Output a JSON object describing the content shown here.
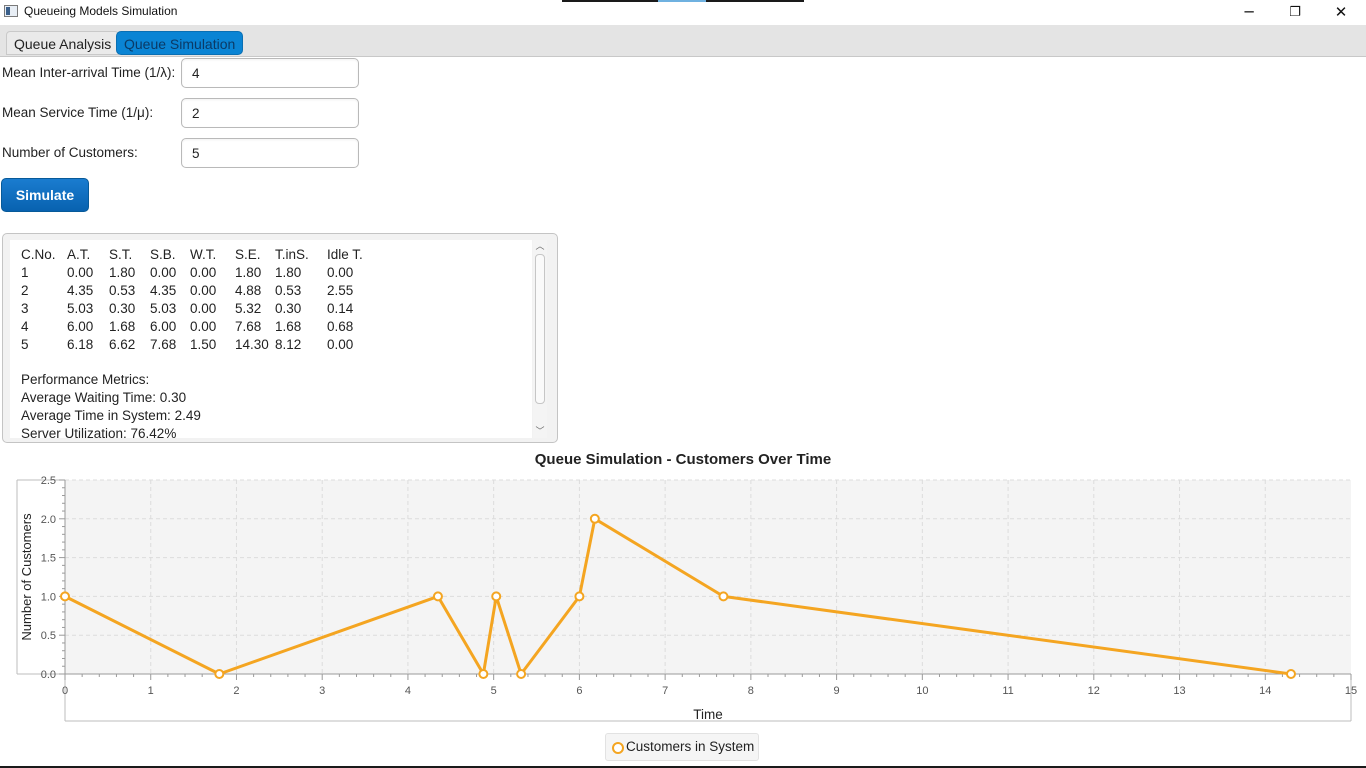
{
  "window": {
    "title": "Queueing Models Simulation",
    "minimize_glyph": "─",
    "restore_glyph": "❐",
    "close_glyph": "✕"
  },
  "tabs": [
    {
      "label": "Queue Analysis",
      "selected": false
    },
    {
      "label": "Queue Simulation",
      "selected": true
    }
  ],
  "form": {
    "inter_arrival_label": "Mean Inter-arrival Time (1/λ):",
    "inter_arrival_value": "4",
    "service_label": "Mean Service Time (1/μ):",
    "service_value": "2",
    "customers_label": "Number of Customers:",
    "customers_value": "5",
    "simulate_label": "Simulate"
  },
  "results": {
    "headers": [
      "C.No.",
      "A.T.",
      "S.T.",
      "S.B.",
      "W.T.",
      "S.E.",
      "T.inS.",
      "Idle T."
    ],
    "rows": [
      [
        "1",
        "0.00",
        "1.80",
        "0.00",
        "0.00",
        "1.80",
        "1.80",
        "0.00"
      ],
      [
        "2",
        "4.35",
        "0.53",
        "4.35",
        "0.00",
        "4.88",
        "0.53",
        "2.55"
      ],
      [
        "3",
        "5.03",
        "0.30",
        "5.03",
        "0.00",
        "5.32",
        "0.30",
        "0.14"
      ],
      [
        "4",
        "6.00",
        "1.68",
        "6.00",
        "0.00",
        "7.68",
        "1.68",
        "0.68"
      ],
      [
        "5",
        "6.18",
        "6.62",
        "7.68",
        "1.50",
        "14.30",
        "8.12",
        "0.00"
      ]
    ],
    "metrics_title": "Performance Metrics:",
    "avg_waiting": "Average Waiting Time: 0.30",
    "avg_time_system": "Average Time in System: 2.49",
    "utilization": "Server Utilization: 76.42%"
  },
  "chart_data": {
    "type": "line",
    "title": "Queue Simulation - Customers Over Time",
    "xlabel": "Time",
    "ylabel": "Number of Customers",
    "xlim": [
      0,
      15
    ],
    "ylim": [
      0,
      2.5
    ],
    "x_ticks": [
      "0",
      "1",
      "2",
      "3",
      "4",
      "5",
      "6",
      "7",
      "8",
      "9",
      "10",
      "11",
      "12",
      "13",
      "14",
      "15"
    ],
    "y_ticks": [
      "0.0",
      "0.5",
      "1.0",
      "1.5",
      "2.0",
      "2.5"
    ],
    "grid": true,
    "legend_position": "bottom-center",
    "series": [
      {
        "name": "Customers in System",
        "color": "#f4a521",
        "points": [
          {
            "x": 0.0,
            "y": 1
          },
          {
            "x": 1.8,
            "y": 0
          },
          {
            "x": 4.35,
            "y": 1
          },
          {
            "x": 4.88,
            "y": 0
          },
          {
            "x": 5.03,
            "y": 1
          },
          {
            "x": 5.32,
            "y": 0
          },
          {
            "x": 6.0,
            "y": 1
          },
          {
            "x": 6.18,
            "y": 2
          },
          {
            "x": 7.68,
            "y": 1
          },
          {
            "x": 14.3,
            "y": 0
          }
        ]
      }
    ]
  }
}
